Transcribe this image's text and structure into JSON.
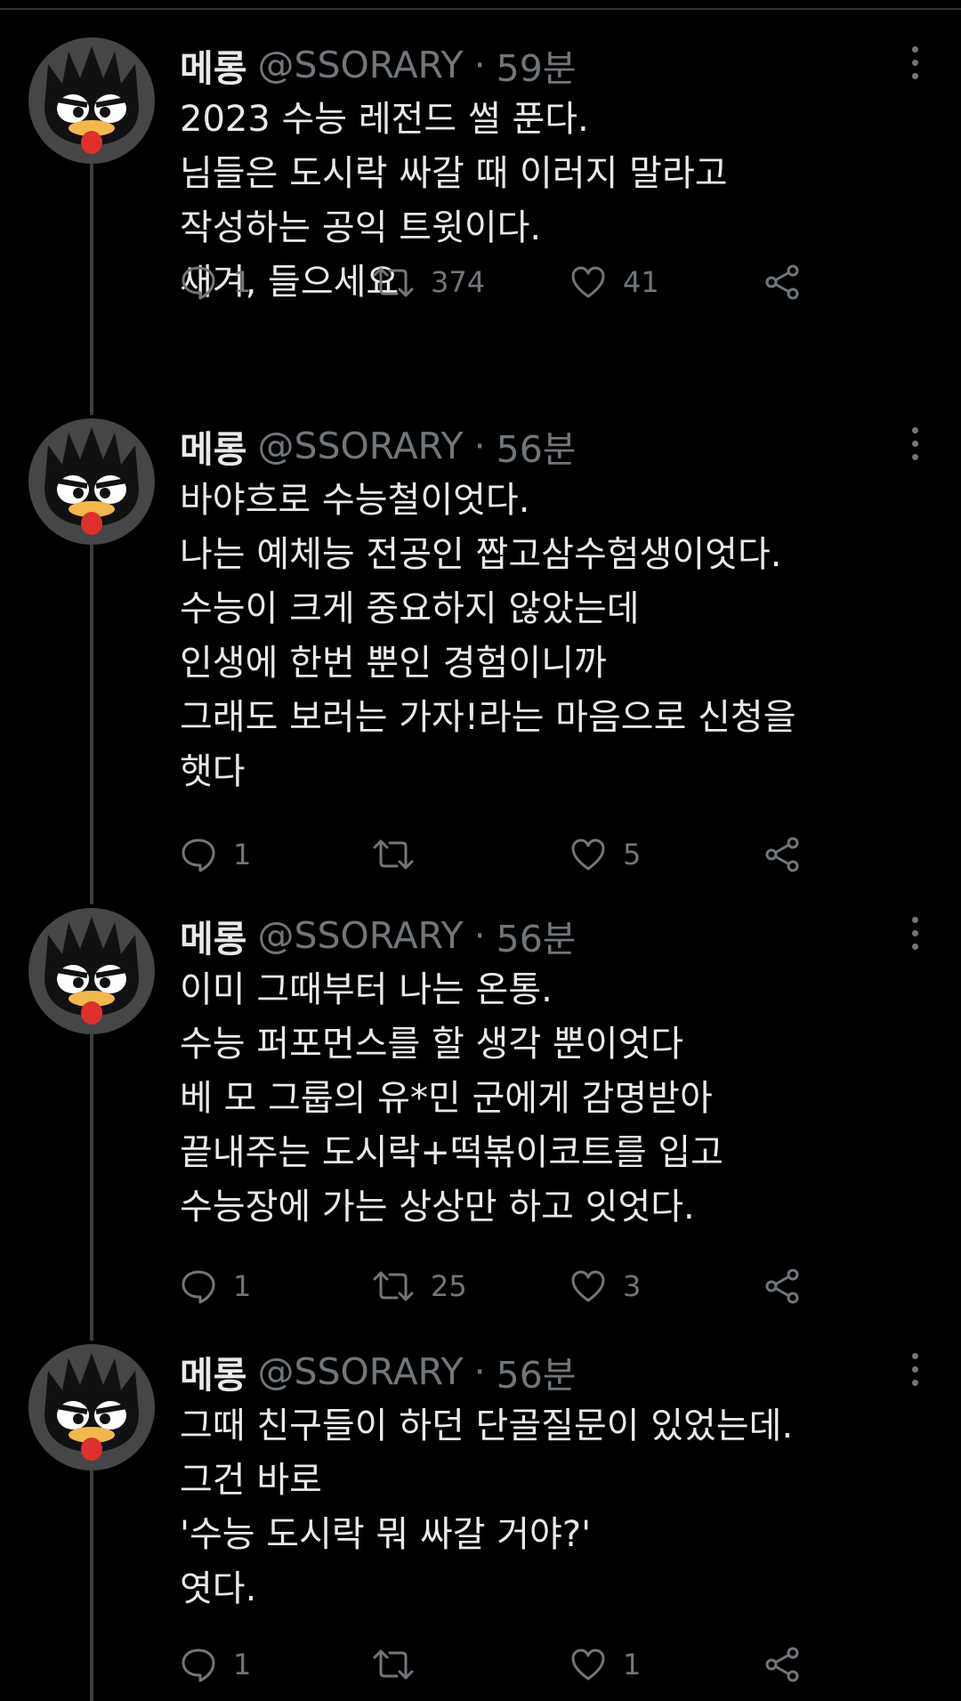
{
  "theme": {
    "background": "#000000",
    "text": "#e7e9ea",
    "muted": "#71767b",
    "thread_line": "#3a3d40"
  },
  "tweets": [
    {
      "display_name": "메롱",
      "handle": "@SSORARY",
      "separator": "·",
      "time": "59분",
      "lines": [
        "2023 수능 레전드 썰 푼다.",
        "님들은 도시락 싸갈 때 이러지 말라고",
        "작성하는 공익 트윗이다.",
        "새겨, 들으세요"
      ],
      "replies": "1",
      "retweets": "374",
      "likes": "41"
    },
    {
      "display_name": "메롱",
      "handle": "@SSORARY",
      "separator": "·",
      "time": "56분",
      "lines": [
        "바야흐로 수능철이엇다.",
        "나는 예체능 전공인 짭고삼수험생이엇다.",
        "수능이 크게 중요하지 않았는데",
        "인생에 한번 뿐인 경험이니까",
        "그래도 보러는 가자!라는 마음으로 신청을",
        "햇다"
      ],
      "replies": "1",
      "retweets": "",
      "likes": "5"
    },
    {
      "display_name": "메롱",
      "handle": "@SSORARY",
      "separator": "·",
      "time": "56분",
      "lines": [
        "이미 그때부터 나는 온통.",
        "수능 퍼포먼스를 할 생각 뿐이엇다",
        "베 모 그룹의 유*민 군에게 감명받아",
        "끝내주는 도시락+떡볶이코트를 입고",
        "수능장에 가는 상상만 하고 잇엇다."
      ],
      "replies": "1",
      "retweets": "25",
      "likes": "3"
    },
    {
      "display_name": "메롱",
      "handle": "@SSORARY",
      "separator": "·",
      "time": "56분",
      "lines": [
        "그때 친구들이 하던 단골질문이 있었는데.",
        "그건 바로",
        "'수능 도시락 뭐 싸갈 거야?'",
        "엿다."
      ],
      "replies": "1",
      "retweets": "",
      "likes": "1"
    }
  ]
}
